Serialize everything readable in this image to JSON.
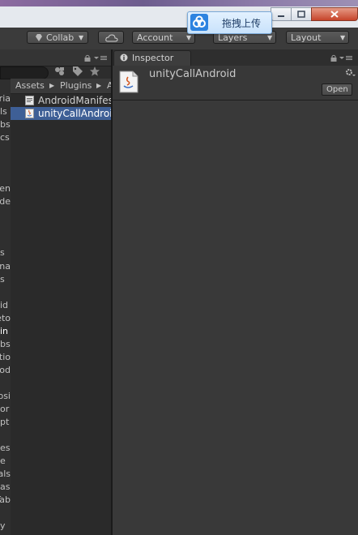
{
  "upload_badge": {
    "label": "拖拽上传"
  },
  "toolbar": {
    "collab_label": "Collab",
    "account_label": "Account",
    "layers_label": "Layers",
    "layout_label": "Layout"
  },
  "project": {
    "breadcrumb": [
      "Assets",
      "Plugins",
      "A"
    ],
    "files": [
      {
        "name": "AndroidManifest",
        "icon": "xml-file-icon",
        "selected": false
      },
      {
        "name": "unityCallAndroid",
        "icon": "java-file-icon",
        "selected": true
      }
    ]
  },
  "hierarchy": {
    "items": [
      "ria",
      "ls",
      "bs",
      "cs",
      "en",
      "de",
      "s",
      "na",
      "s",
      "id",
      "eto",
      "in",
      "bs",
      "tio",
      "od",
      "osi",
      "or",
      "pt",
      "es",
      "e",
      "als",
      "as",
      "Tab",
      "y"
    ]
  },
  "inspector": {
    "tab_label": "Inspector",
    "asset_name": "unityCallAndroid",
    "open_label": "Open"
  },
  "colors": {
    "selection": "#3e5f96",
    "panel_bg": "#393939",
    "toolbar_bg": "#3b3b3b"
  }
}
